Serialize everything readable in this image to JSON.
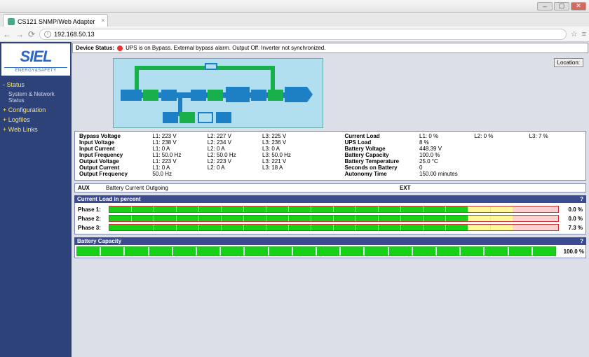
{
  "browser": {
    "tab_title": "CS121 SNMP/Web Adapter",
    "url": "192.168.50.13"
  },
  "logo": {
    "brand": "SIEL",
    "tag": "ENERGY&SAFETY"
  },
  "nav": {
    "status": "Status",
    "status_sub": "System & Network Status",
    "config": "Configuration",
    "logfiles": "Logfiles",
    "weblinks": "Web Links"
  },
  "status": {
    "label": "Device Status:",
    "text": "UPS is on Bypass. External bypass alarm. Output Off. Inverter not synchronized."
  },
  "location_btn": "Location:",
  "metrics": {
    "rows": [
      {
        "label": "Bypass Voltage",
        "l1": "L1: 223 V",
        "l2": "L2: 227 V",
        "l3": "L3: 225 V"
      },
      {
        "label": "Input Voltage",
        "l1": "L1: 238 V",
        "l2": "L2: 234 V",
        "l3": "L3: 236 V"
      },
      {
        "label": "Input Current",
        "l1": "L1: 0 A",
        "l2": "L2: 0 A",
        "l3": "L3: 0 A"
      },
      {
        "label": "Input Frequency",
        "l1": "L1: 50.0 Hz",
        "l2": "L2: 50.0 Hz",
        "l3": "L3: 50.0 Hz"
      },
      {
        "label": "Output Voltage",
        "l1": "L1: 223 V",
        "l2": "L2: 223 V",
        "l3": "L3: 221 V"
      },
      {
        "label": "Output Current",
        "l1": "L1: 0 A",
        "l2": "L2: 0 A",
        "l3": "L3: 18 A"
      },
      {
        "label": "Output Frequency",
        "l1": "50.0 Hz",
        "l2": "",
        "l3": ""
      }
    ],
    "right": [
      {
        "label": "Current Load",
        "v": "L1: 0 %",
        "v2": "L2: 0 %",
        "v3": "L3: 7 %"
      },
      {
        "label": "UPS Load",
        "v": "8 %"
      },
      {
        "label": "Battery Voltage",
        "v": "448.39 V"
      },
      {
        "label": "Battery Capacity",
        "v": "100.0 %"
      },
      {
        "label": "Battery Temperature",
        "v": "25.0 °C"
      },
      {
        "label": "Seconds on Battery",
        "v": "0"
      },
      {
        "label": "Autonomy Time",
        "v": "150.00 minutes"
      }
    ]
  },
  "aux": {
    "k1": "AUX",
    "v1": "Battery Current Outgoing",
    "k2": "EXT"
  },
  "load": {
    "title": "Current Load in percent",
    "phases": [
      {
        "label": "Phase 1:",
        "pct": "0.0 %",
        "fill": 0
      },
      {
        "label": "Phase 2:",
        "pct": "0.0 %",
        "fill": 0
      },
      {
        "label": "Phase 3:",
        "pct": "7.3 %",
        "fill": 7.3
      }
    ]
  },
  "battery": {
    "title": "Battery Capacity",
    "pct": "100.0 %"
  },
  "chart_data": {
    "type": "bar",
    "title": "Current Load in percent",
    "categories": [
      "Phase 1",
      "Phase 2",
      "Phase 3"
    ],
    "values": [
      0.0,
      0.0,
      7.3
    ],
    "ylim": [
      0,
      100
    ],
    "ylabel": "%",
    "battery_capacity_pct": 100.0
  }
}
